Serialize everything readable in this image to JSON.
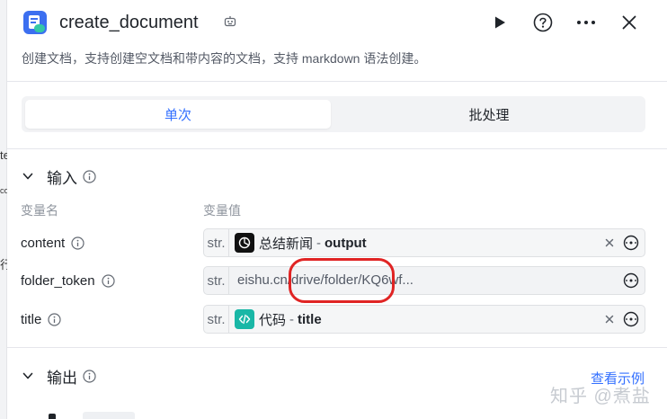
{
  "window": {
    "title": "create_document",
    "description": "创建文档，支持创建空文档和带内容的文档，支持 markdown 语法创建。"
  },
  "left_sliver": {
    "fragments": [
      "te",
      "co",
      "行"
    ]
  },
  "header": {
    "icons": [
      "document-app-icon",
      "robot-icon",
      "play-icon",
      "help-icon",
      "more-icon",
      "close-icon"
    ]
  },
  "tabs": [
    {
      "label": "单次",
      "active": true
    },
    {
      "label": "批处理",
      "active": false
    }
  ],
  "input_section": {
    "title": "输入",
    "columns": {
      "name": "变量名",
      "value": "变量值"
    },
    "rows": [
      {
        "name": "content",
        "type": "str.",
        "kind": "reference",
        "source": "总结新闻",
        "separator": "-",
        "variable": "output",
        "source_icon": "chatgpt-icon"
      },
      {
        "name": "folder_token",
        "type": "str.",
        "kind": "text",
        "value": "eishu.cn/drive/folder/KQ6wf..."
      },
      {
        "name": "title",
        "type": "str.",
        "kind": "reference",
        "source": "代码",
        "separator": "-",
        "variable": "title",
        "source_icon": "code-icon"
      }
    ]
  },
  "output_section": {
    "title": "输出",
    "example_link": "查看示例"
  },
  "watermark": "知乎 @煮盐",
  "colors": {
    "accent": "#3370ff",
    "annotation": "#e02424",
    "code_icon": "#19b7a6"
  }
}
